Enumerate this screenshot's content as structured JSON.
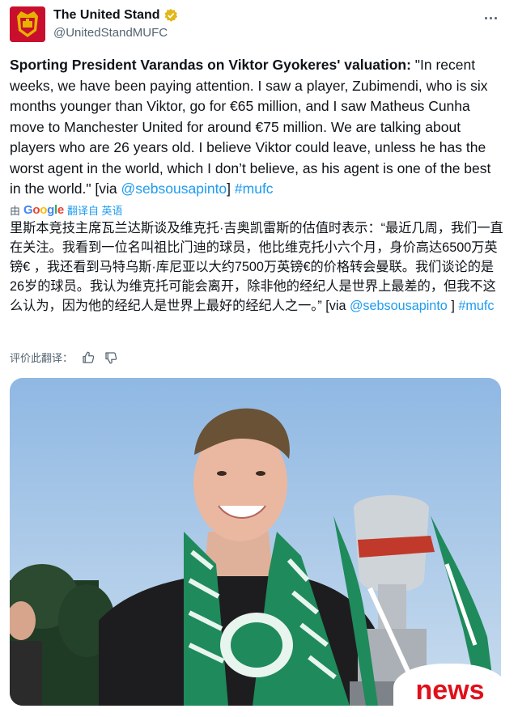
{
  "account": {
    "name": "The United Stand",
    "handle": "@UnitedStandMUFC",
    "verified": true,
    "brand_color": "#c8102e"
  },
  "tweet": {
    "lead_bold": "Sporting President Varandas on Viktor Gyokeres' valuation:",
    "body": " \"In recent weeks, we have been paying attention. I saw a player, Zubimendi, who is six months younger than Viktor, go for €65 million, and I saw Matheus Cunha move to Manchester United for around €75 million. We are talking about players who are 26 years old. I believe Viktor could leave, unless he has the worst agent in the world, which I don’t believe, as his agent is one of the best in the world.\" [via ",
    "mention": "@sebsousapinto",
    "mid": "] ",
    "hashtag": "#mufc"
  },
  "translation": {
    "by_label": "由",
    "provider": "Google",
    "action": "翻译自 英语",
    "text": "里斯本竞技主席瓦兰达斯谈及维克托·吉奥凯雷斯的估值时表示：“最近几周，我们一直在关注。我看到一位名叫祖比门迪的球员，他比维克托小六个月，身价高达6500万英镑€ ，我还看到马特乌斯·库尼亚以大约7500万英镑€的价格转会曼联。我们谈论的是26岁的球员。我认为维克托可能会离开，除非他的经纪人是世界上最差的，但我不这么认为，因为他的经纪人是世界上最好的经纪人之一。” [via ",
    "mention": "@sebsousapinto",
    "mid": " ] ",
    "hashtag": "#mufc",
    "rate_label": "评价此翻译："
  },
  "media": {
    "badge_text": "news",
    "badge_color": "#e0101a",
    "scarf_color": "#1f8a5b"
  },
  "colors": {
    "link": "#1d9bf0",
    "muted": "#536471",
    "verified": "#e2b719"
  }
}
